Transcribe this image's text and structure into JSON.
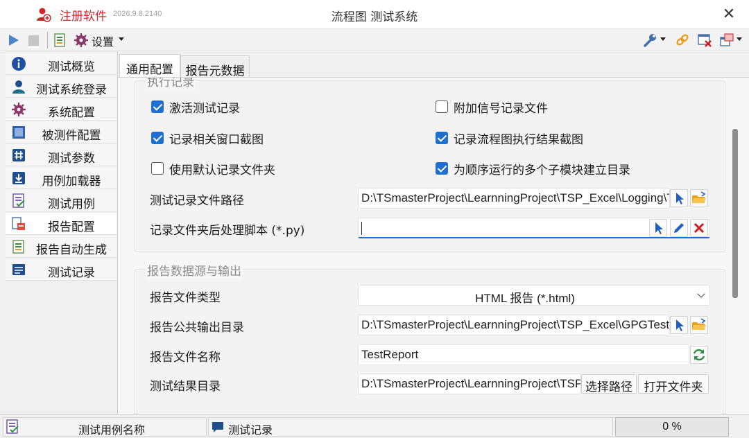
{
  "app": {
    "register_label": "注册软件",
    "version": "2026.9.8.2140",
    "window_title": "流程图 测试系统",
    "close_glyph": "✕"
  },
  "toolbar": {
    "settings_label": "设置",
    "icons": [
      "play-icon",
      "stop-icon",
      "report-icon",
      "gear-icon",
      "wrench-icon",
      "link-icon",
      "close-window-icon",
      "restore-window-icon"
    ]
  },
  "sidebar": {
    "items": [
      {
        "label": "测试概览",
        "icon": "info-icon"
      },
      {
        "label": "测试系统登录",
        "icon": "user-icon"
      },
      {
        "label": "系统配置",
        "icon": "gear-icon"
      },
      {
        "label": "被测件配置",
        "icon": "chip-icon"
      },
      {
        "label": "测试参数",
        "icon": "hash-icon"
      },
      {
        "label": "用例加载器",
        "icon": "download-icon"
      },
      {
        "label": "测试用例",
        "icon": "checklist-icon"
      },
      {
        "label": "报告配置",
        "icon": "report-config-icon"
      },
      {
        "label": "报告自动生成",
        "icon": "report-gen-icon"
      },
      {
        "label": "测试记录",
        "icon": "log-icon"
      }
    ],
    "active_index": 7
  },
  "tabs": [
    {
      "label": "通用配置",
      "active": true
    },
    {
      "label": "报告元数据",
      "active": false
    }
  ],
  "exec_group": {
    "title": "执行记录",
    "checkboxes": [
      {
        "label": "激活测试记录",
        "checked": true
      },
      {
        "label": "附加信号记录文件",
        "checked": false
      },
      {
        "label": "记录相关窗口截图",
        "checked": true
      },
      {
        "label": "记录流程图执行结果截图",
        "checked": true
      },
      {
        "label": "使用默认记录文件夹",
        "checked": false
      },
      {
        "label": "为顺序运行的多个子模块建立目录",
        "checked": true
      }
    ],
    "log_path_label": "测试记录文件路径",
    "log_path_value": "D:\\TSmasterProject\\LearnningProject\\TSP_Excel\\Logging\\TSP_Excel",
    "script_label": "记录文件夹后处理脚本 (*.py)",
    "script_value": ""
  },
  "report_group": {
    "title": "报告数据源与输出",
    "type_label": "报告文件类型",
    "type_value": "HTML 报告 (*.html)",
    "out_dir_label": "报告公共输出目录",
    "out_dir_value": "D:\\TSmasterProject\\LearnningProject\\TSP_Excel\\GPGTestSystem",
    "name_label": "报告文件名称",
    "name_value": "TestReport",
    "result_dir_label": "测试结果目录",
    "result_dir_value": "D:\\TSmasterProject\\LearnningProject\\TSP_Excel",
    "choose_path_label": "选择路径",
    "open_folder_label": "打开文件夹"
  },
  "statusbar": {
    "case_name_label": "测试用例名称",
    "log_label": "测试记录",
    "progress_percent": 0,
    "progress_text": "0 %"
  },
  "colors": {
    "accent": "#1f6fd1",
    "register_red": "#d8232a",
    "pick_blue": "#1f5fbf",
    "delete_red": "#d11a1a",
    "folder_orange": "#e8a020"
  }
}
